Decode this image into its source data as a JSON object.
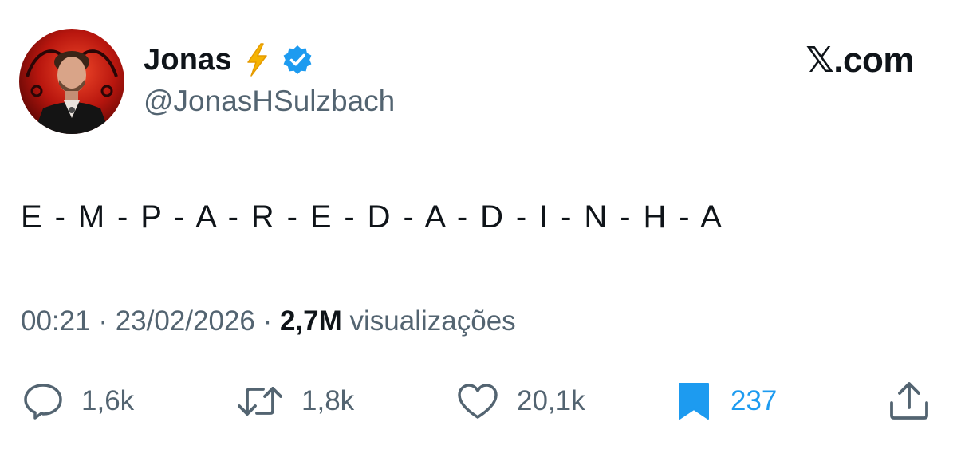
{
  "author": {
    "display_name": "Jonas",
    "name_emoji": "lightning-bolt",
    "verified": true,
    "handle": "@JonasHSulzbach"
  },
  "site": {
    "logo_text": "𝕏.com"
  },
  "tweet": {
    "text": "E-M-P-A-R-E-D-A-D-I-N-H-A",
    "time": "00:21",
    "separator": " · ",
    "date": "23/02/2026",
    "views_count": "2,7M",
    "views_label": "visualizações"
  },
  "actions": {
    "replies": {
      "icon": "reply-icon",
      "count": "1,6k"
    },
    "reposts": {
      "icon": "repost-icon",
      "count": "1,8k"
    },
    "likes": {
      "icon": "heart-icon",
      "count": "20,1k"
    },
    "bookmarks": {
      "icon": "bookmark-icon",
      "count": "237",
      "active": true
    },
    "share": {
      "icon": "share-icon"
    }
  },
  "colors": {
    "text_primary": "#0f1419",
    "text_secondary": "#536471",
    "accent_blue": "#1d9bf0",
    "bolt_yellow": "#f5b301"
  }
}
